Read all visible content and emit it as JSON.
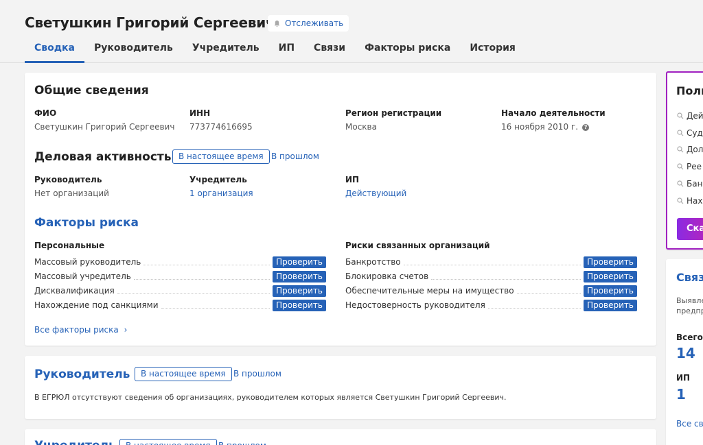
{
  "header": {
    "title": "Светушкин Григорий Сергеевич",
    "follow_label": "Отслеживать",
    "tabs": [
      "Сводка",
      "Руководитель",
      "Учредитель",
      "ИП",
      "Связи",
      "Факторы риска",
      "История"
    ]
  },
  "general": {
    "title": "Общие сведения",
    "fields": [
      {
        "label": "ФИО",
        "value": "Светушкин Григорий Сергеевич"
      },
      {
        "label": "ИНН",
        "value": "773774616695"
      },
      {
        "label": "Регион регистрации",
        "value": "Москва"
      },
      {
        "label": "Начало деятельности",
        "value": "16 ноября 2010 г."
      }
    ]
  },
  "activity": {
    "title": "Деловая активность",
    "now_label": "В настоящее время",
    "past_label": "В прошлом",
    "fields": [
      {
        "label": "Руководитель",
        "value": "Нет организаций"
      },
      {
        "label": "Учредитель",
        "value": "1 организация"
      },
      {
        "label": "ИП",
        "value": "Действующий"
      }
    ]
  },
  "risk": {
    "title": "Факторы риска",
    "check_label": "Проверить",
    "personal": {
      "title": "Персональные",
      "items": [
        "Массовый руководитель",
        "Массовый учредитель",
        "Дисквалификация",
        "Нахождение под санкциями"
      ]
    },
    "related": {
      "title": "Риски связанных организаций",
      "items": [
        "Банкротство",
        "Блокировка счетов",
        "Обеспечительные меры на имущество",
        "Недостоверность руководителя"
      ]
    },
    "all_link": "Все факторы риска"
  },
  "leader": {
    "title": "Руководитель",
    "now_label": "В настоящее время",
    "past_label": "В прошлом",
    "text": "В ЕГРЮЛ отсутствуют сведения об организациях, руководителем которых является Светушкин Григорий Сергеевич."
  },
  "founder": {
    "title": "Учредитель",
    "now_label": "В настоящее время",
    "past_label": "В прошлом"
  },
  "right_full": {
    "title": "Полн",
    "items": [
      "Дей",
      "Суд",
      "Дол",
      "Рее",
      "Бан",
      "Нах"
    ],
    "button": "Ска"
  },
  "right_links": {
    "title": "Связ",
    "desc_line1": "Выявле",
    "desc_line2": "предпр",
    "total_label": "Всего",
    "total_value": "14",
    "ip_label": "ИП",
    "ip_value": "1",
    "all_link": "Все св"
  },
  "colors": {
    "accent": "#2662b7",
    "background": "#f3f3f3",
    "promo_border": "#a020c0"
  }
}
